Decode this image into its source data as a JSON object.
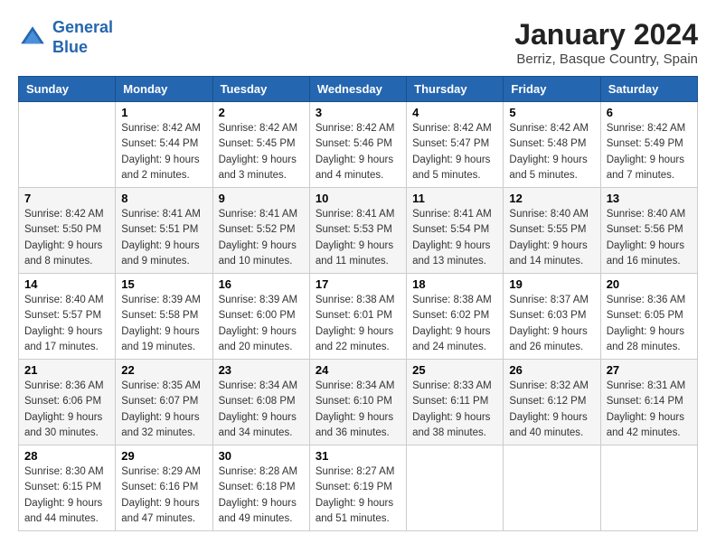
{
  "header": {
    "logo_line1": "General",
    "logo_line2": "Blue",
    "month_title": "January 2024",
    "location": "Berriz, Basque Country, Spain"
  },
  "weekdays": [
    "Sunday",
    "Monday",
    "Tuesday",
    "Wednesday",
    "Thursday",
    "Friday",
    "Saturday"
  ],
  "weeks": [
    [
      {
        "day": "",
        "sunrise": "",
        "sunset": "",
        "daylight": ""
      },
      {
        "day": "1",
        "sunrise": "Sunrise: 8:42 AM",
        "sunset": "Sunset: 5:44 PM",
        "daylight": "Daylight: 9 hours and 2 minutes."
      },
      {
        "day": "2",
        "sunrise": "Sunrise: 8:42 AM",
        "sunset": "Sunset: 5:45 PM",
        "daylight": "Daylight: 9 hours and 3 minutes."
      },
      {
        "day": "3",
        "sunrise": "Sunrise: 8:42 AM",
        "sunset": "Sunset: 5:46 PM",
        "daylight": "Daylight: 9 hours and 4 minutes."
      },
      {
        "day": "4",
        "sunrise": "Sunrise: 8:42 AM",
        "sunset": "Sunset: 5:47 PM",
        "daylight": "Daylight: 9 hours and 5 minutes."
      },
      {
        "day": "5",
        "sunrise": "Sunrise: 8:42 AM",
        "sunset": "Sunset: 5:48 PM",
        "daylight": "Daylight: 9 hours and 5 minutes."
      },
      {
        "day": "6",
        "sunrise": "Sunrise: 8:42 AM",
        "sunset": "Sunset: 5:49 PM",
        "daylight": "Daylight: 9 hours and 7 minutes."
      }
    ],
    [
      {
        "day": "7",
        "sunrise": "Sunrise: 8:42 AM",
        "sunset": "Sunset: 5:50 PM",
        "daylight": "Daylight: 9 hours and 8 minutes."
      },
      {
        "day": "8",
        "sunrise": "Sunrise: 8:41 AM",
        "sunset": "Sunset: 5:51 PM",
        "daylight": "Daylight: 9 hours and 9 minutes."
      },
      {
        "day": "9",
        "sunrise": "Sunrise: 8:41 AM",
        "sunset": "Sunset: 5:52 PM",
        "daylight": "Daylight: 9 hours and 10 minutes."
      },
      {
        "day": "10",
        "sunrise": "Sunrise: 8:41 AM",
        "sunset": "Sunset: 5:53 PM",
        "daylight": "Daylight: 9 hours and 11 minutes."
      },
      {
        "day": "11",
        "sunrise": "Sunrise: 8:41 AM",
        "sunset": "Sunset: 5:54 PM",
        "daylight": "Daylight: 9 hours and 13 minutes."
      },
      {
        "day": "12",
        "sunrise": "Sunrise: 8:40 AM",
        "sunset": "Sunset: 5:55 PM",
        "daylight": "Daylight: 9 hours and 14 minutes."
      },
      {
        "day": "13",
        "sunrise": "Sunrise: 8:40 AM",
        "sunset": "Sunset: 5:56 PM",
        "daylight": "Daylight: 9 hours and 16 minutes."
      }
    ],
    [
      {
        "day": "14",
        "sunrise": "Sunrise: 8:40 AM",
        "sunset": "Sunset: 5:57 PM",
        "daylight": "Daylight: 9 hours and 17 minutes."
      },
      {
        "day": "15",
        "sunrise": "Sunrise: 8:39 AM",
        "sunset": "Sunset: 5:58 PM",
        "daylight": "Daylight: 9 hours and 19 minutes."
      },
      {
        "day": "16",
        "sunrise": "Sunrise: 8:39 AM",
        "sunset": "Sunset: 6:00 PM",
        "daylight": "Daylight: 9 hours and 20 minutes."
      },
      {
        "day": "17",
        "sunrise": "Sunrise: 8:38 AM",
        "sunset": "Sunset: 6:01 PM",
        "daylight": "Daylight: 9 hours and 22 minutes."
      },
      {
        "day": "18",
        "sunrise": "Sunrise: 8:38 AM",
        "sunset": "Sunset: 6:02 PM",
        "daylight": "Daylight: 9 hours and 24 minutes."
      },
      {
        "day": "19",
        "sunrise": "Sunrise: 8:37 AM",
        "sunset": "Sunset: 6:03 PM",
        "daylight": "Daylight: 9 hours and 26 minutes."
      },
      {
        "day": "20",
        "sunrise": "Sunrise: 8:36 AM",
        "sunset": "Sunset: 6:05 PM",
        "daylight": "Daylight: 9 hours and 28 minutes."
      }
    ],
    [
      {
        "day": "21",
        "sunrise": "Sunrise: 8:36 AM",
        "sunset": "Sunset: 6:06 PM",
        "daylight": "Daylight: 9 hours and 30 minutes."
      },
      {
        "day": "22",
        "sunrise": "Sunrise: 8:35 AM",
        "sunset": "Sunset: 6:07 PM",
        "daylight": "Daylight: 9 hours and 32 minutes."
      },
      {
        "day": "23",
        "sunrise": "Sunrise: 8:34 AM",
        "sunset": "Sunset: 6:08 PM",
        "daylight": "Daylight: 9 hours and 34 minutes."
      },
      {
        "day": "24",
        "sunrise": "Sunrise: 8:34 AM",
        "sunset": "Sunset: 6:10 PM",
        "daylight": "Daylight: 9 hours and 36 minutes."
      },
      {
        "day": "25",
        "sunrise": "Sunrise: 8:33 AM",
        "sunset": "Sunset: 6:11 PM",
        "daylight": "Daylight: 9 hours and 38 minutes."
      },
      {
        "day": "26",
        "sunrise": "Sunrise: 8:32 AM",
        "sunset": "Sunset: 6:12 PM",
        "daylight": "Daylight: 9 hours and 40 minutes."
      },
      {
        "day": "27",
        "sunrise": "Sunrise: 8:31 AM",
        "sunset": "Sunset: 6:14 PM",
        "daylight": "Daylight: 9 hours and 42 minutes."
      }
    ],
    [
      {
        "day": "28",
        "sunrise": "Sunrise: 8:30 AM",
        "sunset": "Sunset: 6:15 PM",
        "daylight": "Daylight: 9 hours and 44 minutes."
      },
      {
        "day": "29",
        "sunrise": "Sunrise: 8:29 AM",
        "sunset": "Sunset: 6:16 PM",
        "daylight": "Daylight: 9 hours and 47 minutes."
      },
      {
        "day": "30",
        "sunrise": "Sunrise: 8:28 AM",
        "sunset": "Sunset: 6:18 PM",
        "daylight": "Daylight: 9 hours and 49 minutes."
      },
      {
        "day": "31",
        "sunrise": "Sunrise: 8:27 AM",
        "sunset": "Sunset: 6:19 PM",
        "daylight": "Daylight: 9 hours and 51 minutes."
      },
      {
        "day": "",
        "sunrise": "",
        "sunset": "",
        "daylight": ""
      },
      {
        "day": "",
        "sunrise": "",
        "sunset": "",
        "daylight": ""
      },
      {
        "day": "",
        "sunrise": "",
        "sunset": "",
        "daylight": ""
      }
    ]
  ]
}
